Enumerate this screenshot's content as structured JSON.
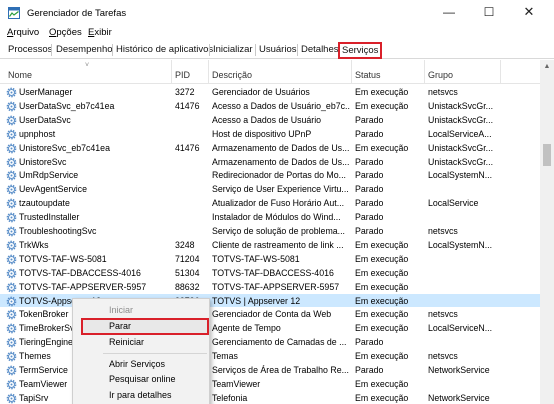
{
  "window": {
    "title": "Gerenciador de Tarefas",
    "minimize": "—",
    "maximize": "☐",
    "close": "✕"
  },
  "menu": {
    "arquivo_acc": "A",
    "arquivo_rest": "rquivo",
    "opcoes_acc": "O",
    "opcoes_rest": "pções",
    "exibir_acc": "E",
    "exibir_rest": "xibir"
  },
  "tabs": [
    "Processos",
    "Desempenho",
    "Histórico de aplicativos",
    "Inicializar",
    "Usuários",
    "Detalhes",
    "Serviços"
  ],
  "active_tab": "Serviços",
  "columns": {
    "name": "Nome",
    "pid": "PID",
    "desc": "Descrição",
    "status": "Status",
    "group": "Grupo"
  },
  "rows": [
    {
      "name": "UserManager",
      "pid": "3272",
      "desc": "Gerenciador de Usuários",
      "status": "Em execução",
      "group": "netsvcs"
    },
    {
      "name": "UserDataSvc_eb7c41ea",
      "pid": "41476",
      "desc": "Acesso a Dados de Usuário_eb7c...",
      "status": "Em execução",
      "group": "UnistackSvcGr..."
    },
    {
      "name": "UserDataSvc",
      "pid": "",
      "desc": "Acesso a Dados de Usuário",
      "status": "Parado",
      "group": "UnistackSvcGr..."
    },
    {
      "name": "upnphost",
      "pid": "",
      "desc": "Host de dispositivo UPnP",
      "status": "Parado",
      "group": "LocalServiceA..."
    },
    {
      "name": "UnistoreSvc_eb7c41ea",
      "pid": "41476",
      "desc": "Armazenamento de Dados de Us...",
      "status": "Em execução",
      "group": "UnistackSvcGr..."
    },
    {
      "name": "UnistoreSvc",
      "pid": "",
      "desc": "Armazenamento de Dados de Us...",
      "status": "Parado",
      "group": "UnistackSvcGr..."
    },
    {
      "name": "UmRdpService",
      "pid": "",
      "desc": "Redirecionador de Portas do Mo...",
      "status": "Parado",
      "group": "LocalSystemN..."
    },
    {
      "name": "UevAgentService",
      "pid": "",
      "desc": "Serviço de User Experience Virtu...",
      "status": "Parado",
      "group": ""
    },
    {
      "name": "tzautoupdate",
      "pid": "",
      "desc": "Atualizador de Fuso Horário Aut...",
      "status": "Parado",
      "group": "LocalService"
    },
    {
      "name": "TrustedInstaller",
      "pid": "",
      "desc": "Instalador de Módulos do Wind...",
      "status": "Parado",
      "group": ""
    },
    {
      "name": "TroubleshootingSvc",
      "pid": "",
      "desc": "Serviço de solução de problema...",
      "status": "Parado",
      "group": "netsvcs"
    },
    {
      "name": "TrkWks",
      "pid": "3248",
      "desc": "Cliente de rastreamento de link ...",
      "status": "Em execução",
      "group": "LocalSystemN..."
    },
    {
      "name": "TOTVS-TAF-WS-5081",
      "pid": "71204",
      "desc": "TOTVS-TAF-WS-5081",
      "status": "Em execução",
      "group": ""
    },
    {
      "name": "TOTVS-TAF-DBACCESS-4016",
      "pid": "51304",
      "desc": "TOTVS-TAF-DBACCESS-4016",
      "status": "Em execução",
      "group": ""
    },
    {
      "name": "TOTVS-TAF-APPSERVER-5957",
      "pid": "88632",
      "desc": "TOTVS-TAF-APPSERVER-5957",
      "status": "Em execução",
      "group": ""
    },
    {
      "name": "TOTVS-Appserver12",
      "pid": "33736",
      "desc": "TOTVS | Appserver 12",
      "status": "Em execução",
      "group": ""
    },
    {
      "name": "TokenBroker",
      "pid": "",
      "desc": "Gerenciador de Conta da Web",
      "status": "Em execução",
      "group": "netsvcs"
    },
    {
      "name": "TimeBrokerSvc",
      "pid": "",
      "desc": "Agente de Tempo",
      "status": "Em execução",
      "group": "LocalServiceN..."
    },
    {
      "name": "TieringEngineService",
      "pid": "",
      "desc": "Gerenciamento de Camadas de ...",
      "status": "Parado",
      "group": ""
    },
    {
      "name": "Themes",
      "pid": "",
      "desc": "Temas",
      "status": "Em execução",
      "group": "netsvcs"
    },
    {
      "name": "TermService",
      "pid": "",
      "desc": "Serviços de Área de Trabalho Re...",
      "status": "Parado",
      "group": "NetworkService"
    },
    {
      "name": "TeamViewer",
      "pid": "",
      "desc": "TeamViewer",
      "status": "Em execução",
      "group": ""
    },
    {
      "name": "TapiSrv",
      "pid": "",
      "desc": "Telefonia",
      "status": "Em execução",
      "group": "NetworkService"
    }
  ],
  "context_menu": {
    "iniciar": "Iniciar",
    "parar": "Parar",
    "reiniciar": "Reiniciar",
    "abrir": "Abrir Serviços",
    "pesquisar": "Pesquisar online",
    "detalhes": "Ir para detalhes"
  },
  "colors": {
    "highlight_border": "#d9202a",
    "selected_row": "#cce8ff",
    "gear": "#5b8fc9"
  },
  "icons": {
    "app": "task-manager-icon",
    "row": "gear-icon"
  }
}
